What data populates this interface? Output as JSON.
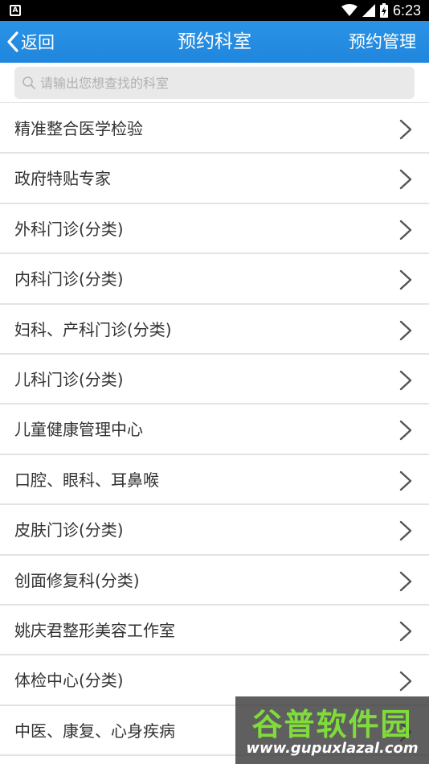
{
  "status_bar": {
    "app_icon_letter": "A",
    "time": "6:23"
  },
  "navbar": {
    "back_label": "返回",
    "title": "预约科室",
    "manage_label": "预约管理",
    "bar_color": "#1f86dd"
  },
  "search": {
    "placeholder": "请输出您想查找的科室",
    "value": ""
  },
  "departments": [
    "精准整合医学检验",
    "政府特贴专家",
    "外科门诊(分类)",
    "内科门诊(分类)",
    "妇科、产科门诊(分类)",
    "儿科门诊(分类)",
    "儿童健康管理中心",
    "口腔、眼科、耳鼻喉",
    "皮肤门诊(分类)",
    "创面修复科(分类)",
    "姚庆君整形美容工作室",
    "体检中心(分类)",
    "中医、康复、心身疾病"
  ],
  "watermark": {
    "title": "谷普软件园",
    "url": "www.gupuxlazal.com"
  },
  "icons": {
    "back": "chevron-left-icon",
    "search": "search-icon",
    "row_arrow": "chevron-right-icon"
  }
}
